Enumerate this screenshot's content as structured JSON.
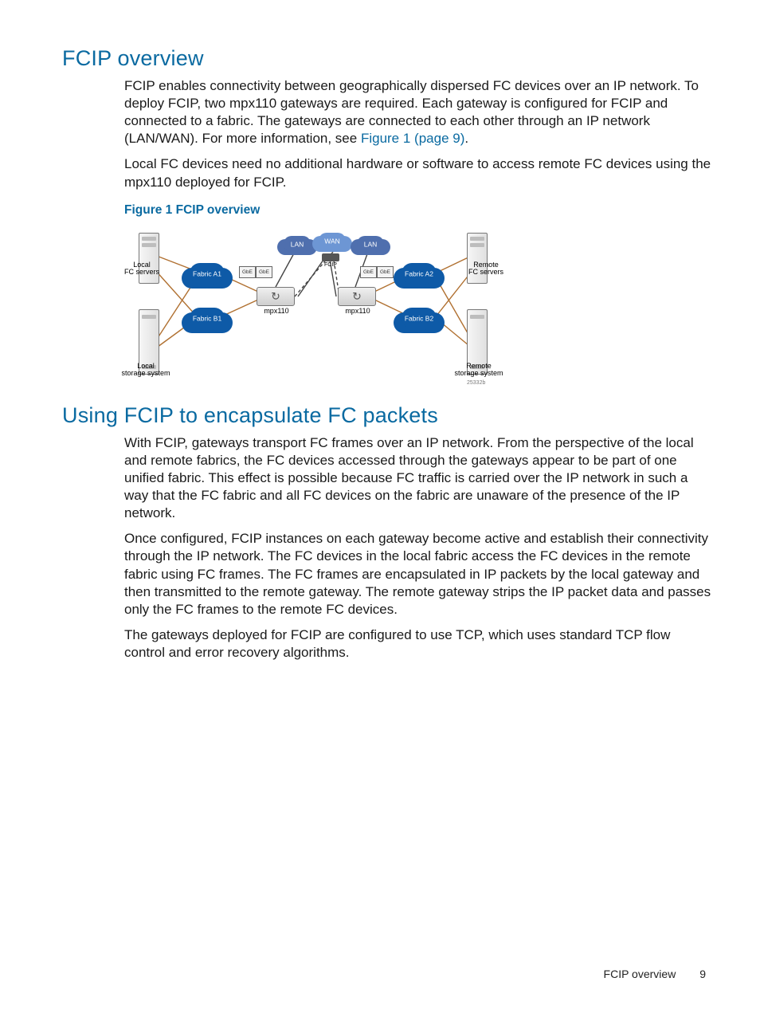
{
  "section1": {
    "title": "FCIP overview",
    "para1_a": "FCIP enables connectivity between geographically dispersed FC devices over an IP network. To deploy FCIP, two mpx110 gateways are required. Each gateway is configured for FCIP and connected to a fabric. The gateways are connected to each other through an IP network (LAN/WAN). For more information, see ",
    "para1_link": "Figure 1 (page 9)",
    "para1_b": ".",
    "para2": "Local FC devices need no additional hardware or software to access remote FC devices using the mpx110 deployed for FCIP.",
    "figure_caption": "Figure 1 FCIP overview"
  },
  "figure": {
    "local_servers": "Local\nFC servers",
    "remote_servers": "Remote\nFC servers",
    "local_storage": "Local\nstorage system",
    "remote_storage": "Remote\nstorage system",
    "fabric_a1": "Fabric A1",
    "fabric_a2": "Fabric A2",
    "fabric_b1": "Fabric B1",
    "fabric_b2": "Fabric B2",
    "lan": "LAN",
    "wan": "WAN",
    "mpx": "mpx110",
    "gbe": "GbE",
    "fcip": "FCIP",
    "ref": "25332b"
  },
  "section2": {
    "title": "Using FCIP to encapsulate FC packets",
    "para1": "With FCIP, gateways transport FC frames over an IP network. From the perspective of the local and remote fabrics, the FC devices accessed through the gateways appear to be part of one unified fabric. This effect is possible because FC traffic is carried over the IP network in such a way that the FC fabric and all FC devices on the fabric are unaware of the presence of the IP network.",
    "para2": "Once configured, FCIP instances on each gateway become active and establish their connectivity through the IP network. The FC devices in the local fabric access the FC devices in the remote fabric using FC frames. The FC frames are encapsulated in IP packets by the local gateway and then transmitted to the remote gateway. The remote gateway strips the IP packet data and passes only the FC frames to the remote FC devices.",
    "para3": "The gateways deployed for FCIP are configured to use TCP, which uses standard TCP flow control and error recovery algorithms."
  },
  "footer": {
    "section": "FCIP overview",
    "page": "9"
  }
}
